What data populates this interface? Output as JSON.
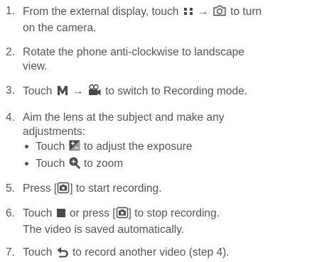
{
  "steps": [
    {
      "num": "1.",
      "pre": "From the external display, touch",
      "arrow": "→",
      "post1": "to turn",
      "line2": "on the camera."
    },
    {
      "num": "2.",
      "line1": "Rotate the phone anti-clockwise to landscape",
      "line2": "view."
    },
    {
      "num": "3.",
      "pre": "Touch",
      "arrow": "→",
      "post": "to switch to Recording mode."
    },
    {
      "num": "4.",
      "line1": "Aim the lens at the subject and make any",
      "line2": "adjustments:",
      "bullets": [
        {
          "pre": "Touch",
          "post": "to adjust the exposure"
        },
        {
          "pre": "Touch",
          "post": "to zoom"
        }
      ]
    },
    {
      "num": "5.",
      "pre": "Press [",
      "post": "] to start recording."
    },
    {
      "num": "6.",
      "pre": "Touch",
      "mid": "or press [",
      "post": "] to stop recording.",
      "line2": "The video is saved automatically."
    },
    {
      "num": "7.",
      "pre": "Touch",
      "post": "to record another video (step 4)."
    }
  ],
  "colors": {
    "text": "#555555",
    "icon": "#4a4a4a"
  }
}
